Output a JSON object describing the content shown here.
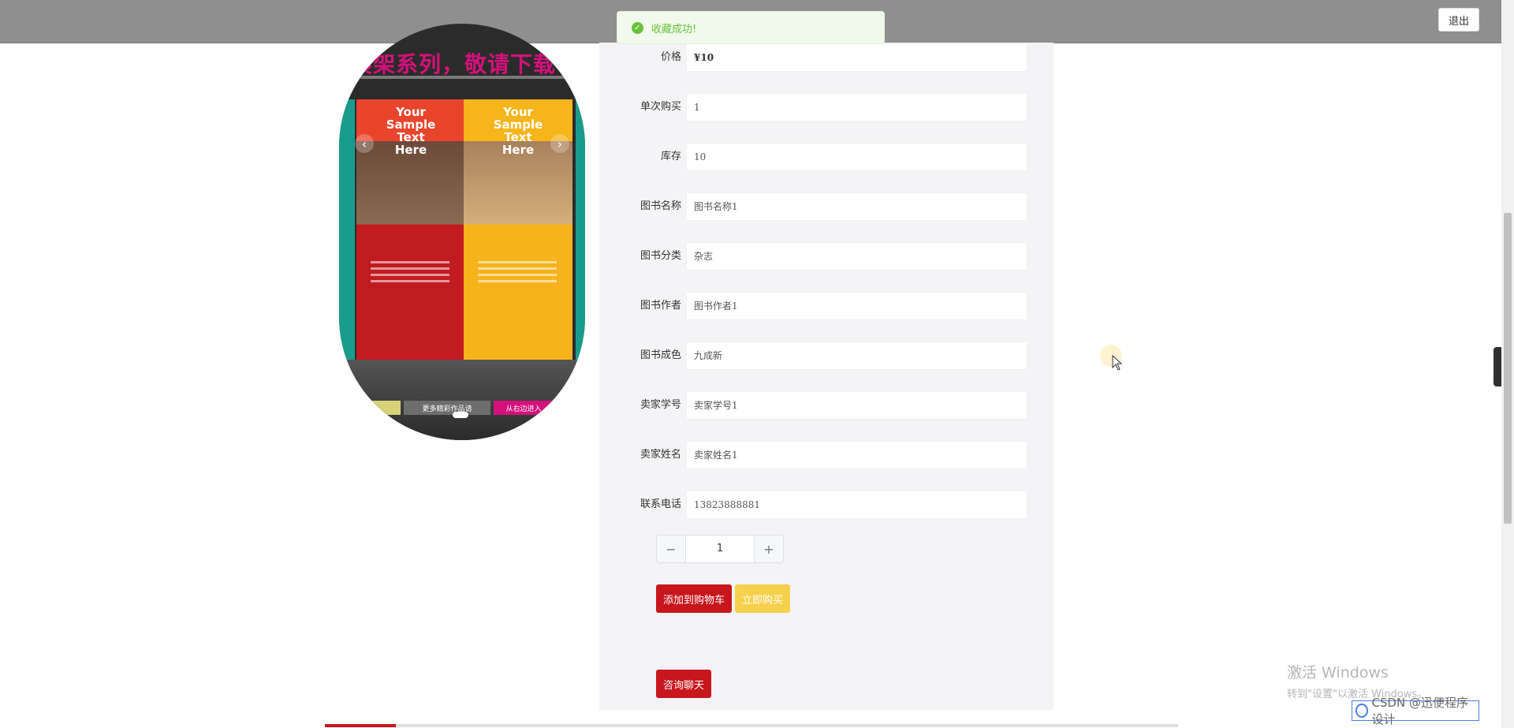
{
  "topbar": {
    "logout_label": "退出"
  },
  "toast": {
    "message": "收藏成功!"
  },
  "carousel": {
    "headline": "展架系列，敬请下载!",
    "poster_text": [
      "Your",
      "Sample",
      "Text",
      "Here"
    ],
    "ribbons": [
      "更多精彩作品请",
      "从右边进入"
    ],
    "prev_icon": "chevron-left-icon",
    "next_icon": "chevron-right-icon"
  },
  "fields": [
    {
      "label": "价格",
      "value": "¥10"
    },
    {
      "label": "单次购买",
      "value": "1"
    },
    {
      "label": "库存",
      "value": "10"
    },
    {
      "label": "图书名称",
      "value": "图书名称1"
    },
    {
      "label": "图书分类",
      "value": "杂志"
    },
    {
      "label": "图书作者",
      "value": "图书作者1"
    },
    {
      "label": "图书成色",
      "value": "九成新"
    },
    {
      "label": "卖家学号",
      "value": "卖家学号1"
    },
    {
      "label": "卖家姓名",
      "value": "卖家姓名1"
    },
    {
      "label": "联系电话",
      "value": "13823888881"
    }
  ],
  "quantity": {
    "value": "1",
    "minus": "−",
    "plus": "+"
  },
  "actions": {
    "add_to_cart": "添加到购物车",
    "buy_now": "立即购买",
    "consult_chat": "咨询聊天"
  },
  "overlay": {
    "watermark_line1": "激活 Windows",
    "watermark_line2": "转到\"设置\"以激活 Windows。",
    "csdn_badge": "CSDN @迅便程序设计"
  },
  "colors": {
    "primary_red": "#c8161d",
    "buy_yellow": "#f7d04c",
    "success_green": "#67c23a"
  }
}
